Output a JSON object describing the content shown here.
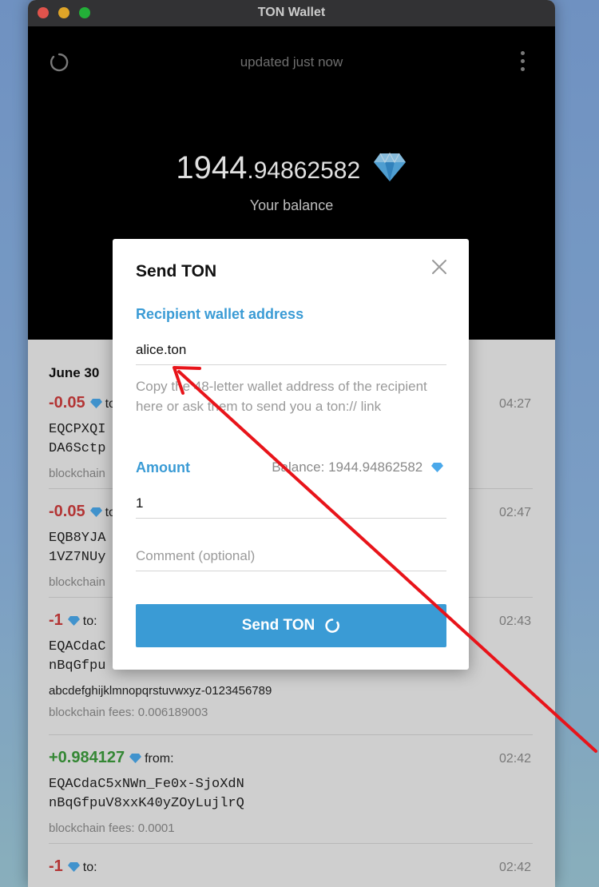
{
  "window": {
    "title": "TON Wallet"
  },
  "header": {
    "status": "updated just now",
    "balance_int": "1944",
    "balance_frac": ".94862582",
    "balance_label": "Your balance",
    "refresh_icon": "refresh-icon",
    "menu_icon": "more-vertical-icon"
  },
  "transactions": {
    "date": "June 30",
    "items": [
      {
        "amount": "-0.05",
        "direction": "to:",
        "time": "04:27",
        "addr1": "EQCPXQI",
        "addr2": "DA6Sctp",
        "fees": "blockchain"
      },
      {
        "amount": "-0.05",
        "direction": "to:",
        "time": "02:47",
        "addr1": "EQB8YJA",
        "addr2": "1VZ7NUy",
        "fees": "blockchain"
      },
      {
        "amount": "-1",
        "direction": "to:",
        "time": "02:43",
        "addr1": "EQACdaC",
        "addr2": "nBqGfpu",
        "comment": "abcdefghijklmnopqrstuvwxyz-0123456789",
        "fees": "blockchain fees: 0.006189003"
      },
      {
        "amount": "+0.984127",
        "direction": "from:",
        "time": "02:42",
        "addr1": "EQACdaC5xNWn_Fe0x-SjoXdN",
        "addr2": "nBqGfpuV8xxK40yZOyLujlrQ",
        "fees": "blockchain fees: 0.0001"
      },
      {
        "amount": "-1",
        "direction": "to:",
        "time": "02:42"
      }
    ]
  },
  "modal": {
    "title": "Send TON",
    "recipient_label": "Recipient wallet address",
    "recipient_value": "alice.ton",
    "recipient_hint": "Copy the 48-letter wallet address of the recipient here or ask them to send you a ton:// link",
    "amount_label": "Amount",
    "balance_hint": "Balance: 1944.94862582",
    "amount_value": "1",
    "comment_placeholder": "Comment (optional)",
    "send_label": "Send TON"
  },
  "colors": {
    "accent": "#3a9bd5",
    "negative": "#cc3d3d",
    "positive": "#3c9a3c",
    "annotation_arrow": "#e8141a"
  }
}
